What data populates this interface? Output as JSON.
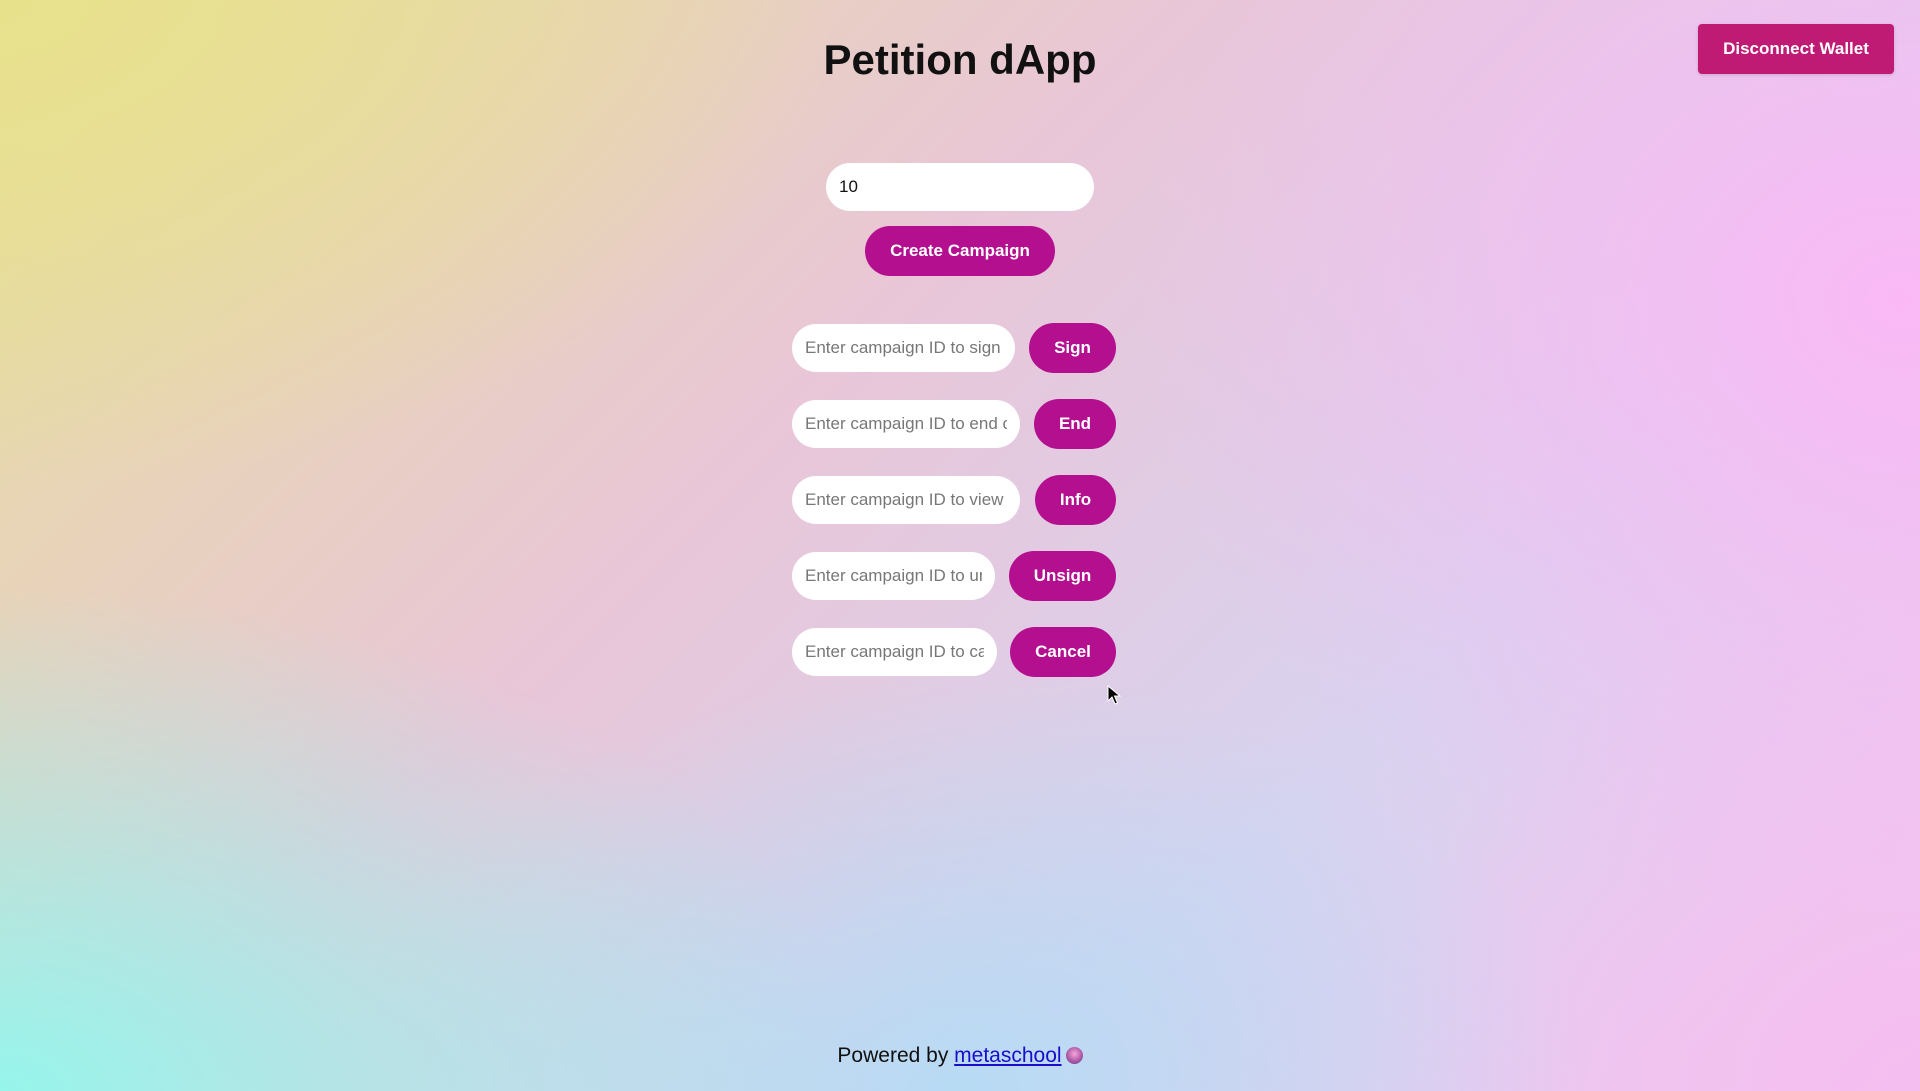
{
  "header": {
    "disconnect_label": "Disconnect Wallet"
  },
  "page_title": "Petition dApp",
  "create": {
    "amount_value": "10",
    "button_label": "Create Campaign"
  },
  "actions": [
    {
      "placeholder": "Enter campaign ID to sign",
      "button_label": "Sign"
    },
    {
      "placeholder": "Enter campaign ID to end campaign",
      "button_label": "End"
    },
    {
      "placeholder": "Enter campaign ID to view",
      "button_label": "Info"
    },
    {
      "placeholder": "Enter campaign ID to unsign",
      "button_label": "Unsign"
    },
    {
      "placeholder": "Enter campaign ID to cancel",
      "button_label": "Cancel"
    }
  ],
  "footer": {
    "prefix": "Powered by",
    "link_label": "metaschool"
  },
  "colors": {
    "button_accent": "#b30f8f",
    "disconnect_accent": "#bf1b74"
  },
  "icons": {
    "footer_emoji": "metaschool-orb-icon",
    "mouse_cursor": "mouse-pointer-icon"
  }
}
